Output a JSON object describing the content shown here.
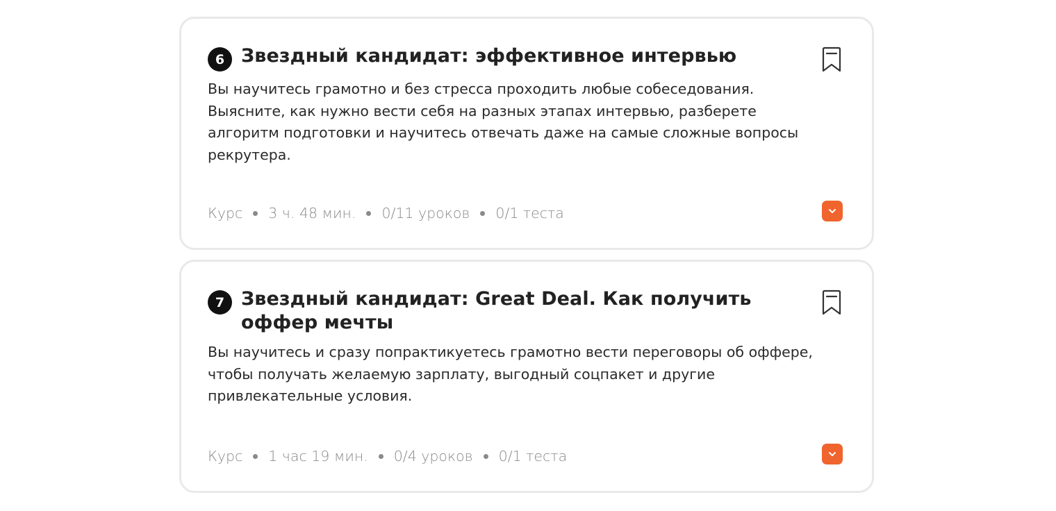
{
  "courses": [
    {
      "number": "6",
      "title": "Звездный кандидат: эффективное интервью",
      "description": "Вы научитесь грамотно и без стресса проходить любые собеседования. Выясните, как нужно вести себя на разных этапах интервью, разберете алгоритм подготовки и научитесь отвечать даже на самые сложные вопросы рекрутера.",
      "meta": {
        "type": "Курс",
        "duration": "3 ч. 48 мин.",
        "lessons": "0/11 уроков",
        "tests": "0/1 теста"
      }
    },
    {
      "number": "7",
      "title": "Звездный кандидат: Great Deal. Как получить оффер мечты",
      "description": "Вы научитесь и сразу попрактикуетесь грамотно вести переговоры об оффере, чтобы получать желаемую зарплату, выгодный соцпакет и другие привлекательные условия.",
      "meta": {
        "type": "Курс",
        "duration": "1 час 19 мин.",
        "lessons": "0/4 уроков",
        "tests": "0/1 теста"
      }
    }
  ],
  "icons": {
    "bookmark": "bookmark-icon",
    "expand": "chevron-down-icon"
  },
  "colors": {
    "accent": "#f0642d",
    "number_badge": "#111111",
    "card_border": "#e9e9e9",
    "meta_text": "#8a8a8a"
  }
}
